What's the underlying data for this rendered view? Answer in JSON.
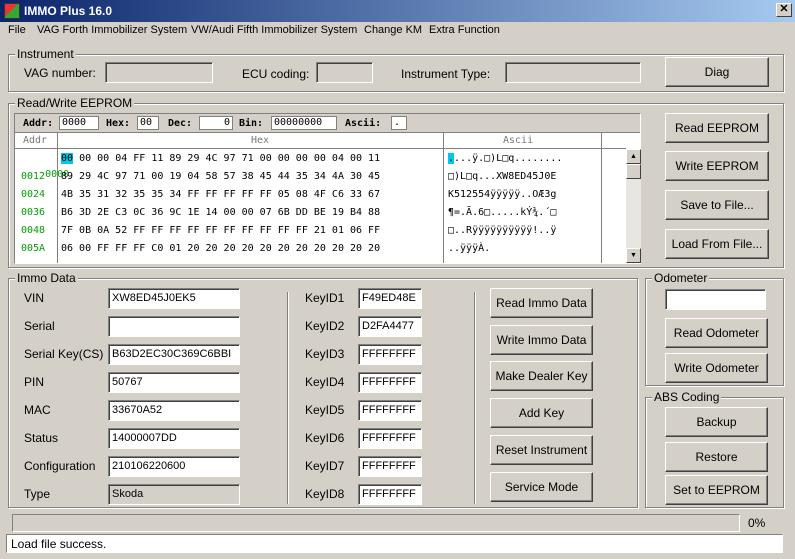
{
  "window": {
    "title": "IMMO Plus 16.0",
    "close": "✕"
  },
  "menu": [
    "File",
    "VAG Forth Immobilizer System",
    "VW/Audi Fifth Immobilizer System",
    "Change KM",
    "Extra Function"
  ],
  "instrument": {
    "title": "Instrument",
    "vag_label": "VAG number:",
    "vag_value": "",
    "ecu_label": "ECU coding:",
    "ecu_value": "",
    "type_label": "Instrument Type:",
    "type_value": "",
    "diag_button": "Diag"
  },
  "eeprom": {
    "title": "Read/Write EEPROM",
    "header": {
      "addr_label": "Addr:",
      "addr_value": "0000",
      "hex_label": "Hex:",
      "hex_value": "00",
      "dec_label": "Dec:",
      "dec_value": "0",
      "bin_label": "Bin:",
      "bin_value": "00000000",
      "ascii_label": "Ascii:",
      "ascii_value": "."
    },
    "col_addr": "Addr",
    "col_hex": "Hex",
    "col_ascii": "Ascii",
    "rows": [
      {
        "addr": "0000",
        "sel_hex": "00",
        "hex": " 00 00 04 FF 11 89 29 4C 97 71 00 00 00 00 04 00 11",
        "sel_ascii": ".",
        "ascii": "...ÿ.□)L□q........"
      },
      {
        "addr": "0012",
        "sel_hex": "",
        "hex": "89 29 4C 97 71 00 19 04 58 57 38 45 44 35 34 4A 30 45",
        "sel_ascii": "",
        "ascii": "□)L□q...XW8ED45J0E"
      },
      {
        "addr": "0024",
        "sel_hex": "",
        "hex": "4B 35 31 32 35 35 34 FF FF FF FF FF 05 08 4F C6 33 67",
        "sel_ascii": "",
        "ascii": "K512554ÿÿÿÿÿ..OÆ3g"
      },
      {
        "addr": "0036",
        "sel_hex": "",
        "hex": "B6 3D 2E C3 0C 36 9C 1E 14 00 00 07 6B DD BE 19 B4 88",
        "sel_ascii": "",
        "ascii": "¶=.Ã.6□.....kÝ¾.´□"
      },
      {
        "addr": "0048",
        "sel_hex": "",
        "hex": "7F 0B 0A 52 FF FF FF FF FF FF FF FF FF FF 21 01 06 FF",
        "sel_ascii": "",
        "ascii": "□..Rÿÿÿÿÿÿÿÿÿÿ!..ÿ"
      },
      {
        "addr": "005A",
        "sel_hex": "",
        "hex": "06 00 FF FF FF C0 01 20 20 20 20 20 20 20 20 20 20 20",
        "sel_ascii": "",
        "ascii": "..ÿÿÿÀ."
      }
    ],
    "buttons": {
      "read": "Read EEPROM",
      "write": "Write EEPROM",
      "save": "Save to File...",
      "load": "Load From File..."
    }
  },
  "immo": {
    "title": "Immo Data",
    "fields": [
      {
        "label": "VIN",
        "value": "XW8ED45J0EK5",
        "disabled": false
      },
      {
        "label": "Serial",
        "value": "",
        "disabled": false
      },
      {
        "label": "Serial Key(CS)",
        "value": "B63D2EC30C369C6BBI",
        "disabled": false
      },
      {
        "label": "PIN",
        "value": "50767",
        "disabled": false
      },
      {
        "label": "MAC",
        "value": "33670A52",
        "disabled": false
      },
      {
        "label": "Status",
        "value": "14000007DD",
        "disabled": false
      },
      {
        "label": "Configuration",
        "value": "210106220600",
        "disabled": false
      },
      {
        "label": "Type",
        "value": "Skoda",
        "disabled": true
      }
    ],
    "keys": [
      {
        "label": "KeyID1",
        "value": "F49ED48E"
      },
      {
        "label": "KeyID2",
        "value": "D2FA4477"
      },
      {
        "label": "KeyID3",
        "value": "FFFFFFFF"
      },
      {
        "label": "KeyID4",
        "value": "FFFFFFFF"
      },
      {
        "label": "KeyID5",
        "value": "FFFFFFFF"
      },
      {
        "label": "KeyID6",
        "value": "FFFFFFFF"
      },
      {
        "label": "KeyID7",
        "value": "FFFFFFFF"
      },
      {
        "label": "KeyID8",
        "value": "FFFFFFFF"
      }
    ],
    "buttons": {
      "read": "Read Immo Data",
      "write": "Write Immo Data",
      "dealer": "Make Dealer Key",
      "add": "Add Key",
      "reset": "Reset Instrument",
      "service": "Service Mode"
    }
  },
  "odometer": {
    "title": "Odometer",
    "value": "",
    "read": "Read Odometer",
    "write": "Write Odometer"
  },
  "abs": {
    "title": "ABS Coding",
    "backup": "Backup",
    "restore": "Restore",
    "set": "Set to EEPROM"
  },
  "progress": {
    "value": 0,
    "text": "0%"
  },
  "status": "Load file success."
}
